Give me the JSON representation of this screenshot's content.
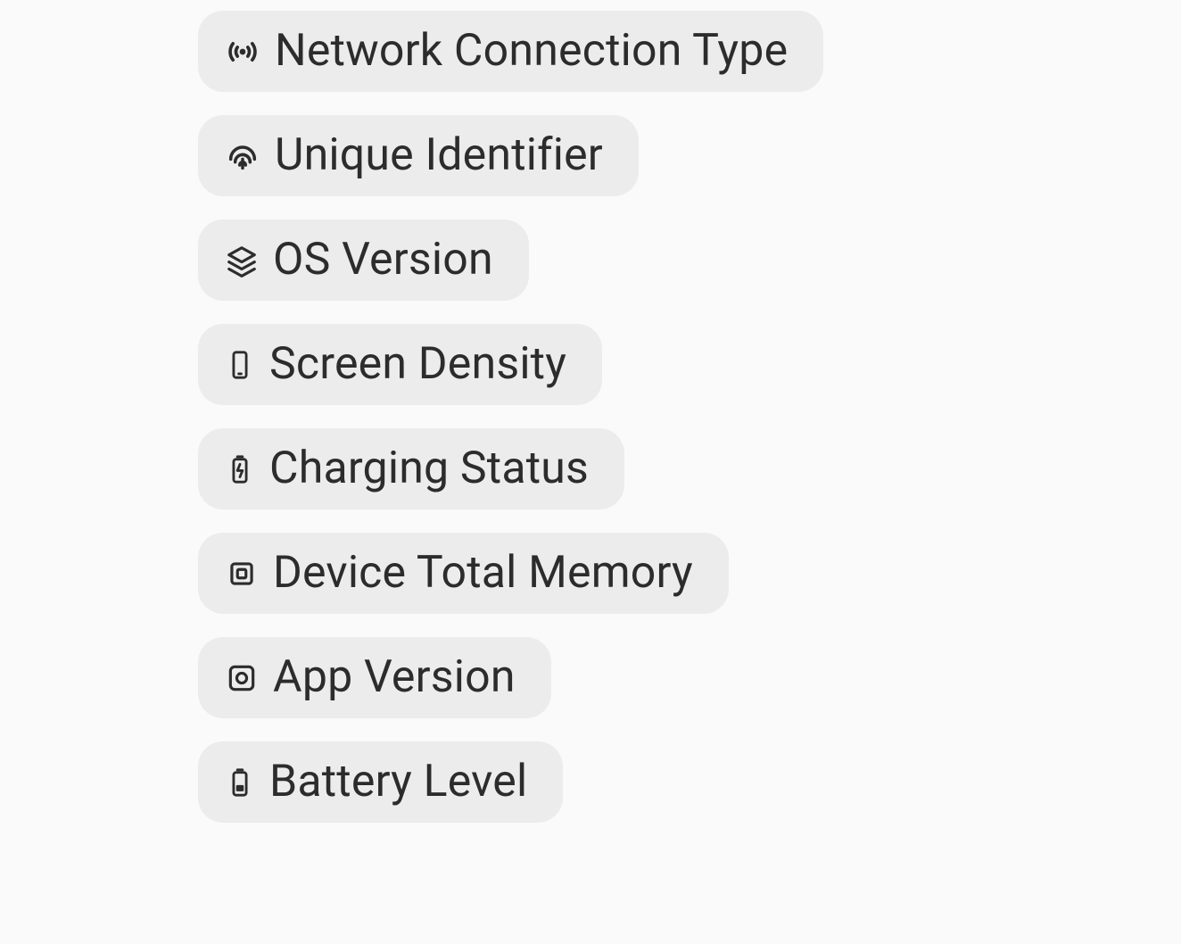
{
  "chips": [
    {
      "icon": "broadcast-icon",
      "label": "Network Connection Type"
    },
    {
      "icon": "fingerprint-icon",
      "label": "Unique Identifier"
    },
    {
      "icon": "layers-icon",
      "label": "OS Version"
    },
    {
      "icon": "phone-icon",
      "label": "Screen Density"
    },
    {
      "icon": "battery-charging-icon",
      "label": "Charging Status"
    },
    {
      "icon": "cpu-icon",
      "label": "Device Total Memory"
    },
    {
      "icon": "app-icon",
      "label": "App Version"
    },
    {
      "icon": "battery-icon",
      "label": "Battery Level"
    }
  ]
}
